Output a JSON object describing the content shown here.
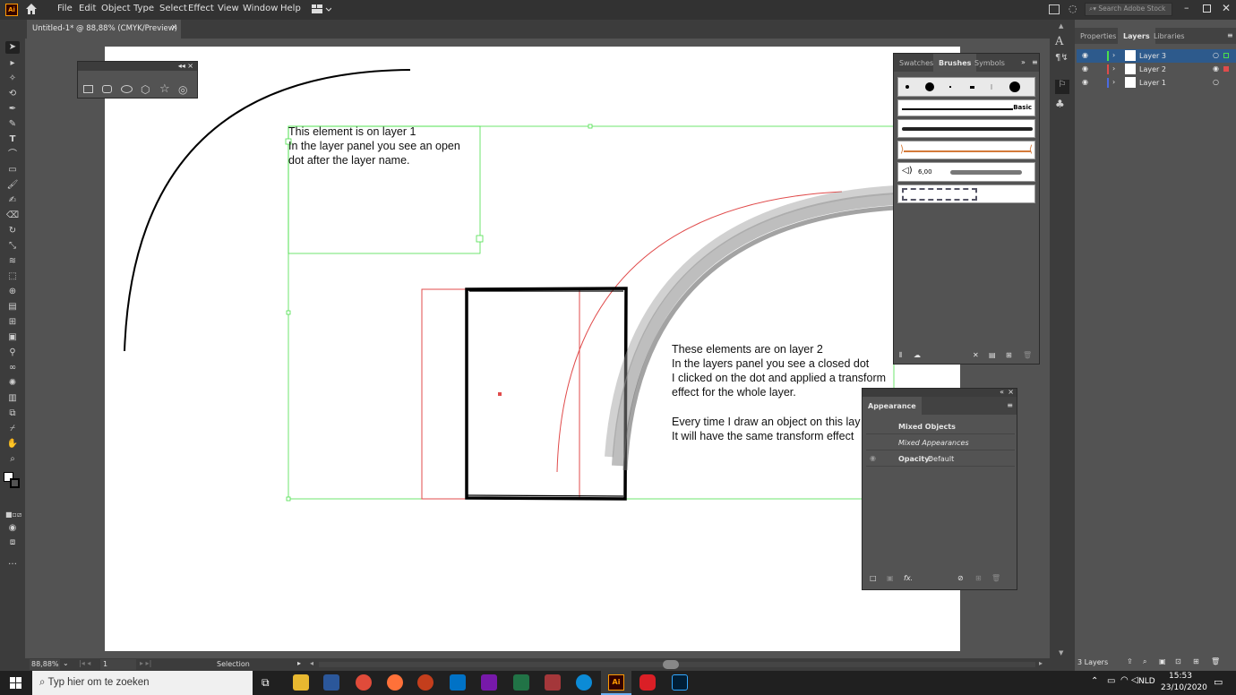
{
  "app": {
    "logo": "Ai"
  },
  "menu": [
    "File",
    "Edit",
    "Object",
    "Type",
    "Select",
    "Effect",
    "View",
    "Window",
    "Help"
  ],
  "search": {
    "placeholder": "Search Adobe Stock"
  },
  "document_tab": {
    "title": "Untitled-1* @ 88,88% (CMYK/Preview)",
    "close": "×"
  },
  "floating_toolbar": {
    "title_glyphs": "◂◂  ×"
  },
  "canvas_text": {
    "layer1_lines": [
      "This element is on layer 1",
      "In the layer panel you see an open",
      "dot after the layer name."
    ],
    "layer2_lines": [
      "These elements are on layer 2",
      " In the layers panel you see a closed dot",
      "I clicked on the dot and applied a transform",
      "effect for the whole layer.",
      "",
      "Every time I draw an object on this lay",
      "It will have the same transform effect"
    ]
  },
  "brushes_panel": {
    "tabs": [
      "Swatches",
      "Brushes",
      "Symbols"
    ],
    "basic_label": "Basic",
    "size_value": "6,00"
  },
  "appearance_panel": {
    "title": "Appearance",
    "rows": [
      "Mixed Objects",
      "Mixed Appearances"
    ],
    "opacity_label": "Opacity:",
    "opacity_value": "Default"
  },
  "layers_panel": {
    "tabs": [
      "Properties",
      "Layers",
      "Libraries"
    ],
    "layers": [
      {
        "name": "Layer 3",
        "color": "#4be04b",
        "selected": true
      },
      {
        "name": "Layer 2",
        "color": "#e04b4b",
        "selected": false
      },
      {
        "name": "Layer 1",
        "color": "#4b6be0",
        "selected": false
      }
    ],
    "footer_count": "3 Layers"
  },
  "statusbar": {
    "zoom": "88,88%",
    "artboard": "1",
    "tool": "Selection"
  },
  "taskbar": {
    "search_placeholder": "Typ hier om te zoeken",
    "lang": "NLD",
    "time": "15:53",
    "date": "23/10/2020"
  },
  "colors": {
    "accent_selection": "#4be04b",
    "layer2": "#e04b4b",
    "layer1": "#4b6be0",
    "ai_orange": "#ff9a00"
  }
}
